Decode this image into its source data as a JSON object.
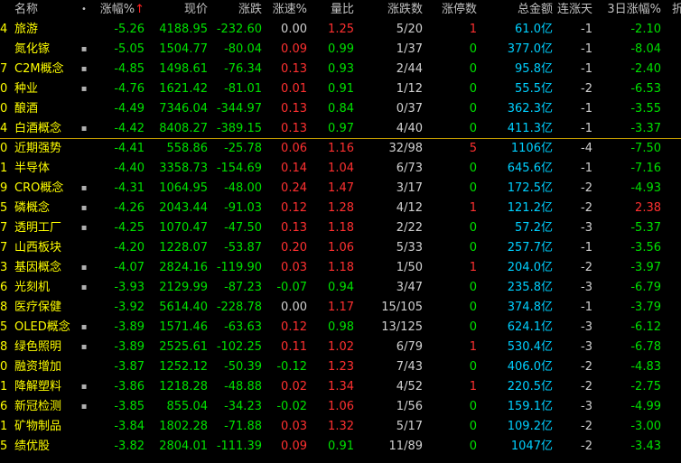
{
  "header": {
    "name": "名称",
    "mark": "•",
    "chg": "涨幅%",
    "sort_arrow": "↑",
    "price": "现价",
    "delta": "涨跌",
    "speed": "涨速%",
    "ratio": "量比",
    "updn": "涨跌数",
    "limit": "涨停数",
    "amt": "总金额",
    "days": "连涨天",
    "d3": "3日涨幅%",
    "extra": "折"
  },
  "rows": [
    {
      "idx": "4",
      "name": "旅游",
      "mark": "",
      "chg": "-5.26",
      "price": "4188.95",
      "delta": "-232.60",
      "speed": "0.00",
      "ratio": "1.25",
      "updn": "5/20",
      "limit": "1",
      "amt": "61.0",
      "unit": "亿",
      "days": "-1",
      "d3": "-2.10"
    },
    {
      "idx": "",
      "name": "氮化镓",
      "mark": "▪",
      "chg": "-5.05",
      "price": "1504.77",
      "delta": "-80.04",
      "speed": "0.09",
      "ratio": "0.99",
      "updn": "1/37",
      "limit": "0",
      "amt": "377.0",
      "unit": "亿",
      "days": "-1",
      "d3": "-8.04"
    },
    {
      "idx": "7",
      "name": "C2M概念",
      "mark": "▪",
      "chg": "-4.85",
      "price": "1498.61",
      "delta": "-76.34",
      "speed": "0.13",
      "ratio": "0.93",
      "updn": "2/44",
      "limit": "0",
      "amt": "95.8",
      "unit": "亿",
      "days": "-1",
      "d3": "-2.40"
    },
    {
      "idx": "0",
      "name": "种业",
      "mark": "▪",
      "chg": "-4.76",
      "price": "1621.42",
      "delta": "-81.01",
      "speed": "0.01",
      "ratio": "0.91",
      "updn": "1/12",
      "limit": "0",
      "amt": "55.5",
      "unit": "亿",
      "days": "-2",
      "d3": "-6.53"
    },
    {
      "idx": "0",
      "name": "酿酒",
      "mark": "",
      "chg": "-4.49",
      "price": "7346.04",
      "delta": "-344.97",
      "speed": "0.13",
      "ratio": "0.84",
      "updn": "0/37",
      "limit": "0",
      "amt": "362.3",
      "unit": "亿",
      "days": "-1",
      "d3": "-3.55"
    },
    {
      "idx": "4",
      "name": "白酒概念",
      "mark": "▪",
      "chg": "-4.42",
      "price": "8408.27",
      "delta": "-389.15",
      "speed": "0.13",
      "ratio": "0.97",
      "updn": "4/40",
      "limit": "0",
      "amt": "411.3",
      "unit": "亿",
      "days": "-1",
      "d3": "-3.37"
    },
    {
      "idx": "0",
      "name": "近期强势",
      "mark": "",
      "chg": "-4.41",
      "price": "558.86",
      "delta": "-25.78",
      "speed": "0.06",
      "ratio": "1.16",
      "updn": "32/98",
      "limit": "5",
      "amt": "1106",
      "unit": "亿",
      "days": "-4",
      "d3": "-7.50"
    },
    {
      "idx": "1",
      "name": "半导体",
      "mark": "",
      "chg": "-4.40",
      "price": "3358.73",
      "delta": "-154.69",
      "speed": "0.14",
      "ratio": "1.04",
      "updn": "6/73",
      "limit": "0",
      "amt": "645.6",
      "unit": "亿",
      "days": "-1",
      "d3": "-7.16"
    },
    {
      "idx": "9",
      "name": "CRO概念",
      "mark": "▪",
      "chg": "-4.31",
      "price": "1064.95",
      "delta": "-48.00",
      "speed": "0.24",
      "ratio": "1.47",
      "updn": "3/17",
      "limit": "0",
      "amt": "172.5",
      "unit": "亿",
      "days": "-2",
      "d3": "-4.93"
    },
    {
      "idx": "5",
      "name": "磷概念",
      "mark": "▪",
      "chg": "-4.26",
      "price": "2043.44",
      "delta": "-91.03",
      "speed": "0.12",
      "ratio": "1.28",
      "updn": "4/12",
      "limit": "1",
      "amt": "121.2",
      "unit": "亿",
      "days": "-2",
      "d3": "2.38"
    },
    {
      "idx": "7",
      "name": "透明工厂",
      "mark": "▪",
      "chg": "-4.25",
      "price": "1070.47",
      "delta": "-47.50",
      "speed": "0.13",
      "ratio": "1.18",
      "updn": "2/22",
      "limit": "0",
      "amt": "57.2",
      "unit": "亿",
      "days": "-3",
      "d3": "-5.37"
    },
    {
      "idx": "7",
      "name": "山西板块",
      "mark": "",
      "chg": "-4.20",
      "price": "1228.07",
      "delta": "-53.87",
      "speed": "0.20",
      "ratio": "1.06",
      "updn": "5/33",
      "limit": "0",
      "amt": "257.7",
      "unit": "亿",
      "days": "-1",
      "d3": "-3.56"
    },
    {
      "idx": "3",
      "name": "基因概念",
      "mark": "▪",
      "chg": "-4.07",
      "price": "2824.16",
      "delta": "-119.90",
      "speed": "0.03",
      "ratio": "1.18",
      "updn": "1/50",
      "limit": "1",
      "amt": "204.0",
      "unit": "亿",
      "days": "-2",
      "d3": "-3.97"
    },
    {
      "idx": "6",
      "name": "光刻机",
      "mark": "▪",
      "chg": "-3.93",
      "price": "2129.99",
      "delta": "-87.23",
      "speed": "-0.07",
      "ratio": "0.94",
      "updn": "3/47",
      "limit": "0",
      "amt": "235.8",
      "unit": "亿",
      "days": "-3",
      "d3": "-6.79"
    },
    {
      "idx": "8",
      "name": "医疗保健",
      "mark": "",
      "chg": "-3.92",
      "price": "5614.40",
      "delta": "-228.78",
      "speed": "0.00",
      "ratio": "1.17",
      "updn": "15/105",
      "limit": "0",
      "amt": "374.8",
      "unit": "亿",
      "days": "-1",
      "d3": "-3.79"
    },
    {
      "idx": "5",
      "name": "OLED概念",
      "mark": "▪",
      "chg": "-3.89",
      "price": "1571.46",
      "delta": "-63.63",
      "speed": "0.12",
      "ratio": "0.98",
      "updn": "13/125",
      "limit": "0",
      "amt": "624.1",
      "unit": "亿",
      "days": "-3",
      "d3": "-6.12"
    },
    {
      "idx": "8",
      "name": "绿色照明",
      "mark": "▪",
      "chg": "-3.89",
      "price": "2525.61",
      "delta": "-102.25",
      "speed": "0.11",
      "ratio": "1.02",
      "updn": "6/79",
      "limit": "1",
      "amt": "530.4",
      "unit": "亿",
      "days": "-3",
      "d3": "-6.78"
    },
    {
      "idx": "0",
      "name": "融资增加",
      "mark": "",
      "chg": "-3.87",
      "price": "1252.12",
      "delta": "-50.39",
      "speed": "-0.12",
      "ratio": "1.23",
      "updn": "7/43",
      "limit": "0",
      "amt": "406.0",
      "unit": "亿",
      "days": "-2",
      "d3": "-4.83"
    },
    {
      "idx": "1",
      "name": "降解塑料",
      "mark": "▪",
      "chg": "-3.86",
      "price": "1218.28",
      "delta": "-48.88",
      "speed": "0.02",
      "ratio": "1.34",
      "updn": "4/52",
      "limit": "1",
      "amt": "220.5",
      "unit": "亿",
      "days": "-2",
      "d3": "-2.75"
    },
    {
      "idx": "6",
      "name": "新冠检测",
      "mark": "▪",
      "chg": "-3.85",
      "price": "855.04",
      "delta": "-34.23",
      "speed": "-0.02",
      "ratio": "1.06",
      "updn": "1/56",
      "limit": "0",
      "amt": "159.1",
      "unit": "亿",
      "days": "-3",
      "d3": "-4.99"
    },
    {
      "idx": "1",
      "name": "矿物制品",
      "mark": "",
      "chg": "-3.84",
      "price": "1802.28",
      "delta": "-71.88",
      "speed": "0.03",
      "ratio": "1.32",
      "updn": "5/17",
      "limit": "0",
      "amt": "109.2",
      "unit": "亿",
      "days": "-2",
      "d3": "-3.00"
    },
    {
      "idx": "5",
      "name": "绩优股",
      "mark": "",
      "chg": "-3.82",
      "price": "2804.01",
      "delta": "-111.39",
      "speed": "0.09",
      "ratio": "0.91",
      "updn": "11/89",
      "limit": "0",
      "amt": "1047",
      "unit": "亿",
      "days": "-2",
      "d3": "-3.43"
    }
  ]
}
